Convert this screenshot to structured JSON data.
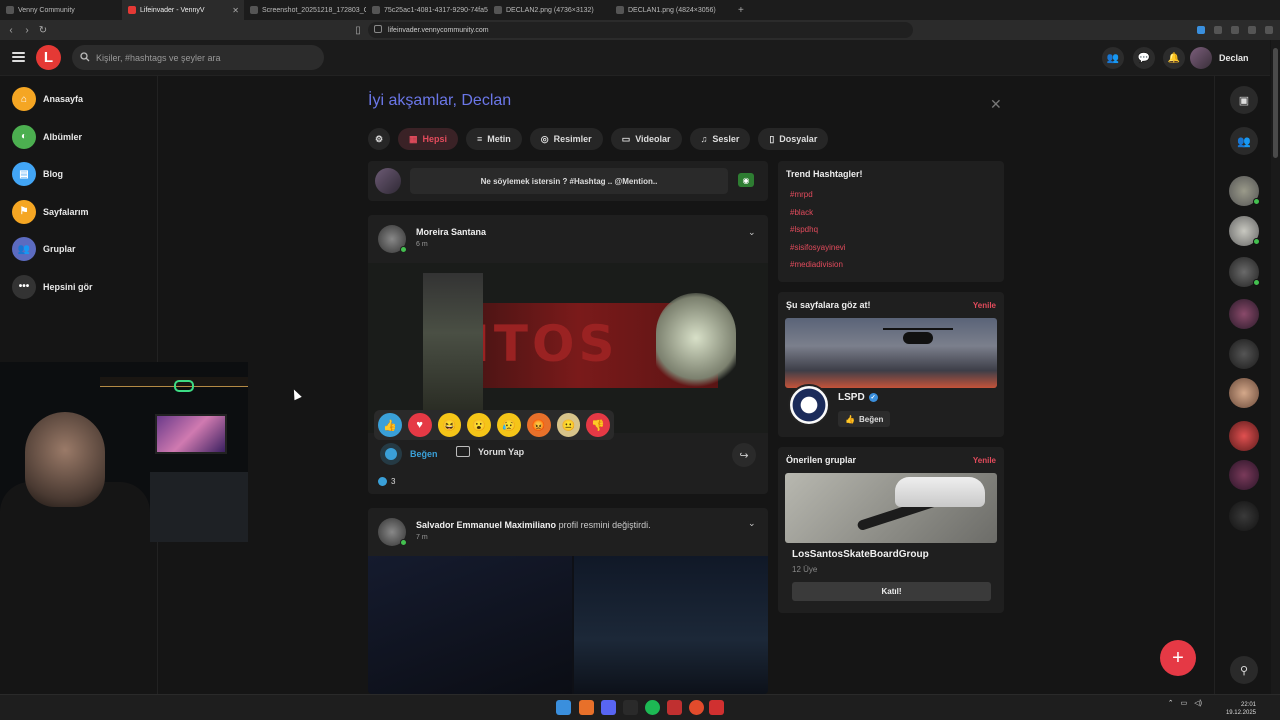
{
  "browser": {
    "tabs": [
      {
        "label": "Venny Community",
        "active": false
      },
      {
        "label": "Lifeinvader - VennyV",
        "active": true
      },
      {
        "label": "Screenshot_20251218_172803_Goog",
        "active": false
      },
      {
        "label": "75c25ac1-4081-4317-9290-74fa5f41",
        "active": false
      },
      {
        "label": "DECLAN2.png (4736×3132)",
        "active": false
      },
      {
        "label": "DECLAN1.png (4824×3056)",
        "active": false
      }
    ],
    "url": "lifeinvader.vennycommunity.com"
  },
  "header": {
    "logo_letter": "L",
    "search_placeholder": "Kişiler, #hashtags ve şeyler ara",
    "user_name": "Declan"
  },
  "sidebar": {
    "items": [
      {
        "label": "Anasayfa",
        "icon": "home-icon",
        "color": "#f5a623"
      },
      {
        "label": "Albümler",
        "icon": "album-icon",
        "color": "#4caf50"
      },
      {
        "label": "Blog",
        "icon": "blog-icon",
        "color": "#42a5f5"
      },
      {
        "label": "Sayfalarım",
        "icon": "flag-icon",
        "color": "#f5a623"
      },
      {
        "label": "Gruplar",
        "icon": "group-icon",
        "color": "#5c6bc0"
      },
      {
        "label": "Hepsini gör",
        "icon": "more-icon",
        "color": "#333333"
      }
    ]
  },
  "main": {
    "greeting": "İyi akşamlar, Declan",
    "filters": [
      {
        "label": "Hepsi",
        "icon": "all-icon",
        "active": true
      },
      {
        "label": "Metin",
        "icon": "text-icon",
        "active": false
      },
      {
        "label": "Resimler",
        "icon": "camera-icon",
        "active": false
      },
      {
        "label": "Videolar",
        "icon": "video-icon",
        "active": false
      },
      {
        "label": "Sesler",
        "icon": "music-icon",
        "active": false
      },
      {
        "label": "Dosyalar",
        "icon": "file-icon",
        "active": false
      }
    ],
    "composer_placeholder": "Ne söylemek istersin ? #Hashtag .. @Mention..",
    "posts": [
      {
        "author": "Moreira Santana",
        "time": "6 m",
        "action": "",
        "image_text": "NTOS",
        "like_label": "Beğen",
        "comment_label": "Yorum Yap",
        "like_count": "3"
      },
      {
        "author": "Salvador Emmanuel Maximiliano",
        "action": "profil resmini değiştirdi.",
        "time": "7 m"
      }
    ],
    "reactions": [
      {
        "name": "like",
        "glyph": "👍",
        "color": "#3aa0d8"
      },
      {
        "name": "love",
        "glyph": "♥",
        "color": "#e53945"
      },
      {
        "name": "haha",
        "glyph": "😆",
        "color": "#f5c518"
      },
      {
        "name": "wow",
        "glyph": "😮",
        "color": "#f5c518"
      },
      {
        "name": "sad",
        "glyph": "😥",
        "color": "#f5c518"
      },
      {
        "name": "angry",
        "glyph": "😡",
        "color": "#e8702a"
      },
      {
        "name": "meh",
        "glyph": "😐",
        "color": "#d8c48a"
      },
      {
        "name": "dislike",
        "glyph": "👎",
        "color": "#e53945"
      }
    ]
  },
  "right": {
    "trends_title": "Trend Hashtagler!",
    "hashtags": [
      "#mrpd",
      "#black",
      "#lspdhq",
      "#sisifosyayinevi",
      "#mediadivision"
    ],
    "pages_title": "Şu sayfalara göz at!",
    "refresh_label": "Yenile",
    "page_name": "LSPD",
    "page_like_label": "Beğen",
    "groups_title": "Önerilen gruplar",
    "group_name": "LosSantosSkateBoardGroup",
    "group_members": "12 Üye",
    "join_label": "Katıl!"
  },
  "taskbar": {
    "time": "22:01",
    "date": "19.12.2025"
  }
}
